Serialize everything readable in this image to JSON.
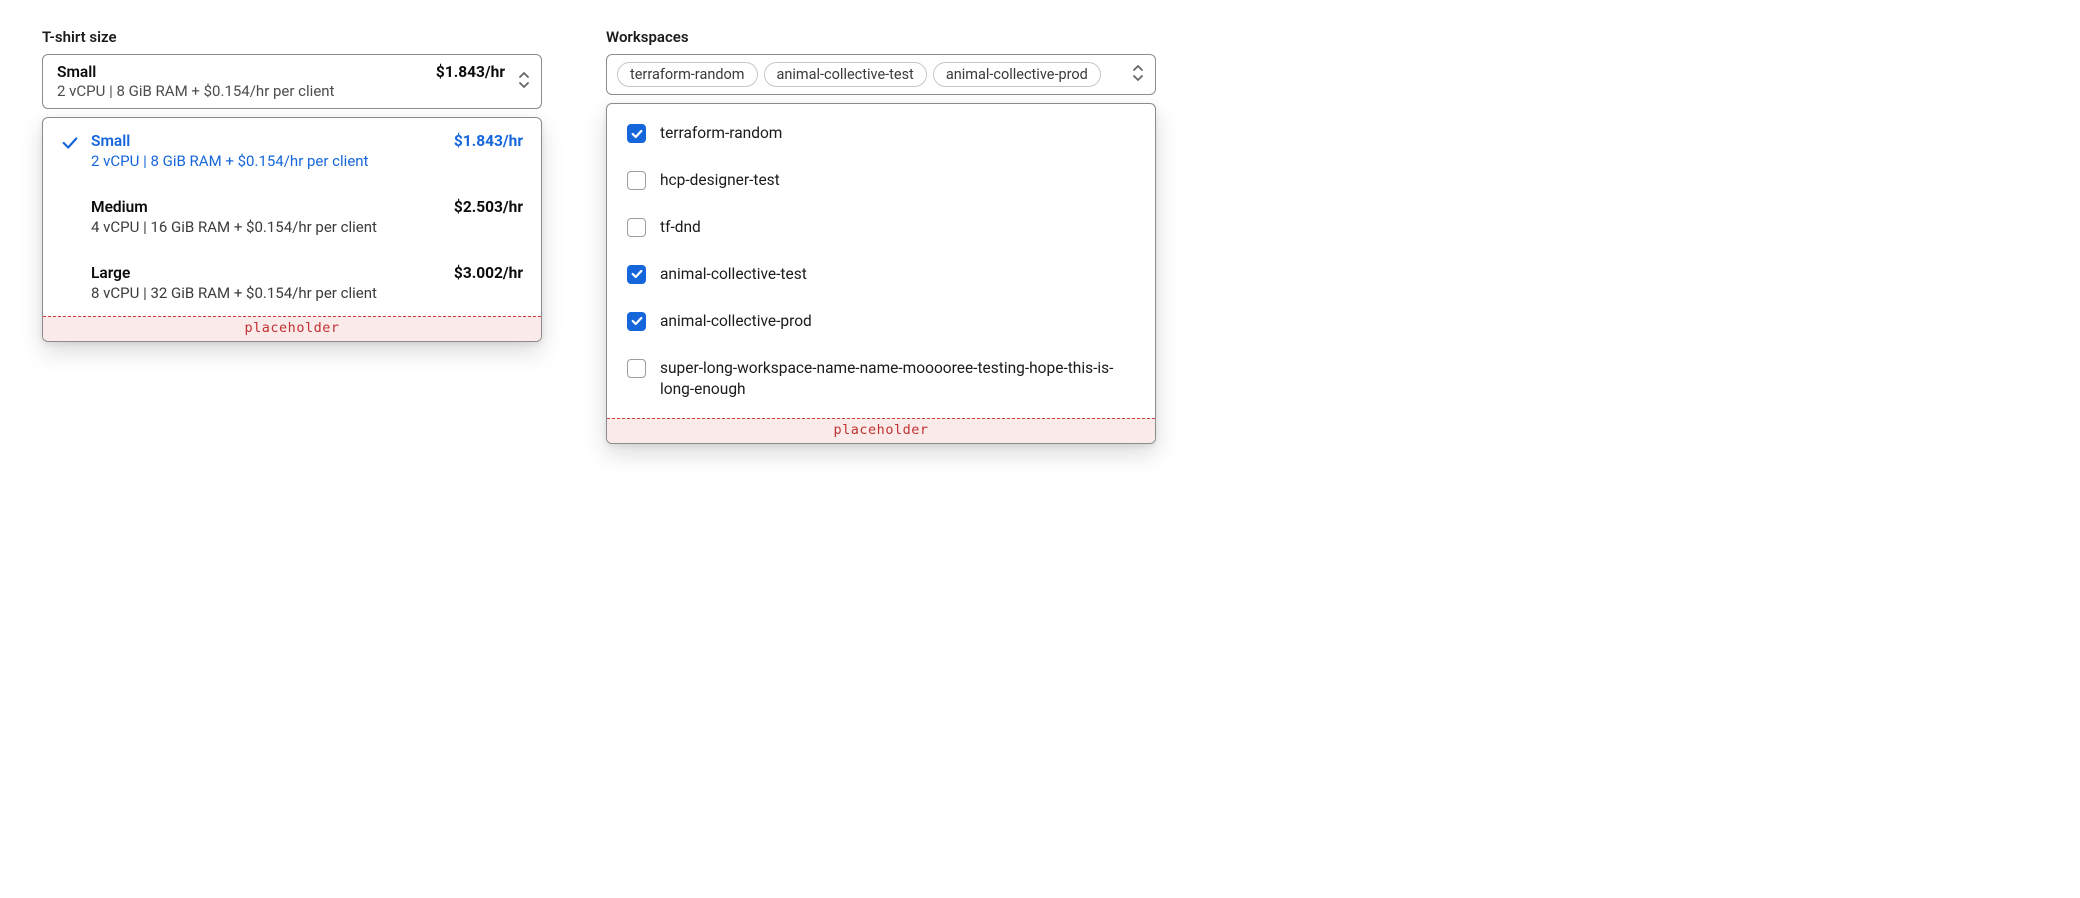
{
  "size_select": {
    "label": "T-shirt size",
    "selected_index": 0,
    "options": [
      {
        "title": "Small",
        "desc": "2 vCPU | 8 GiB RAM + $0.154/hr per client",
        "price": "$1.843/hr"
      },
      {
        "title": "Medium",
        "desc": "4 vCPU | 16 GiB RAM + $0.154/hr per client",
        "price": "$2.503/hr"
      },
      {
        "title": "Large",
        "desc": "8 vCPU | 32 GiB RAM + $0.154/hr per client",
        "price": "$3.002/hr"
      }
    ],
    "placeholder_text": "placeholder"
  },
  "workspaces": {
    "label": "Workspaces",
    "selected_tags": [
      "terraform-random",
      "animal-collective-test",
      "animal-collective-prod"
    ],
    "options": [
      {
        "label": "terraform-random",
        "checked": true
      },
      {
        "label": "hcp-designer-test",
        "checked": false
      },
      {
        "label": "tf-dnd",
        "checked": false
      },
      {
        "label": "animal-collective-test",
        "checked": true
      },
      {
        "label": "animal-collective-prod",
        "checked": true
      },
      {
        "label": "super-long-workspace-name-name-mooooree-testing-hope-this-is-long-enough",
        "checked": false
      }
    ],
    "placeholder_text": "placeholder"
  },
  "colors": {
    "accent": "#1666db",
    "placeholder_bg": "#fbeaea",
    "placeholder_fg": "#c23232"
  }
}
